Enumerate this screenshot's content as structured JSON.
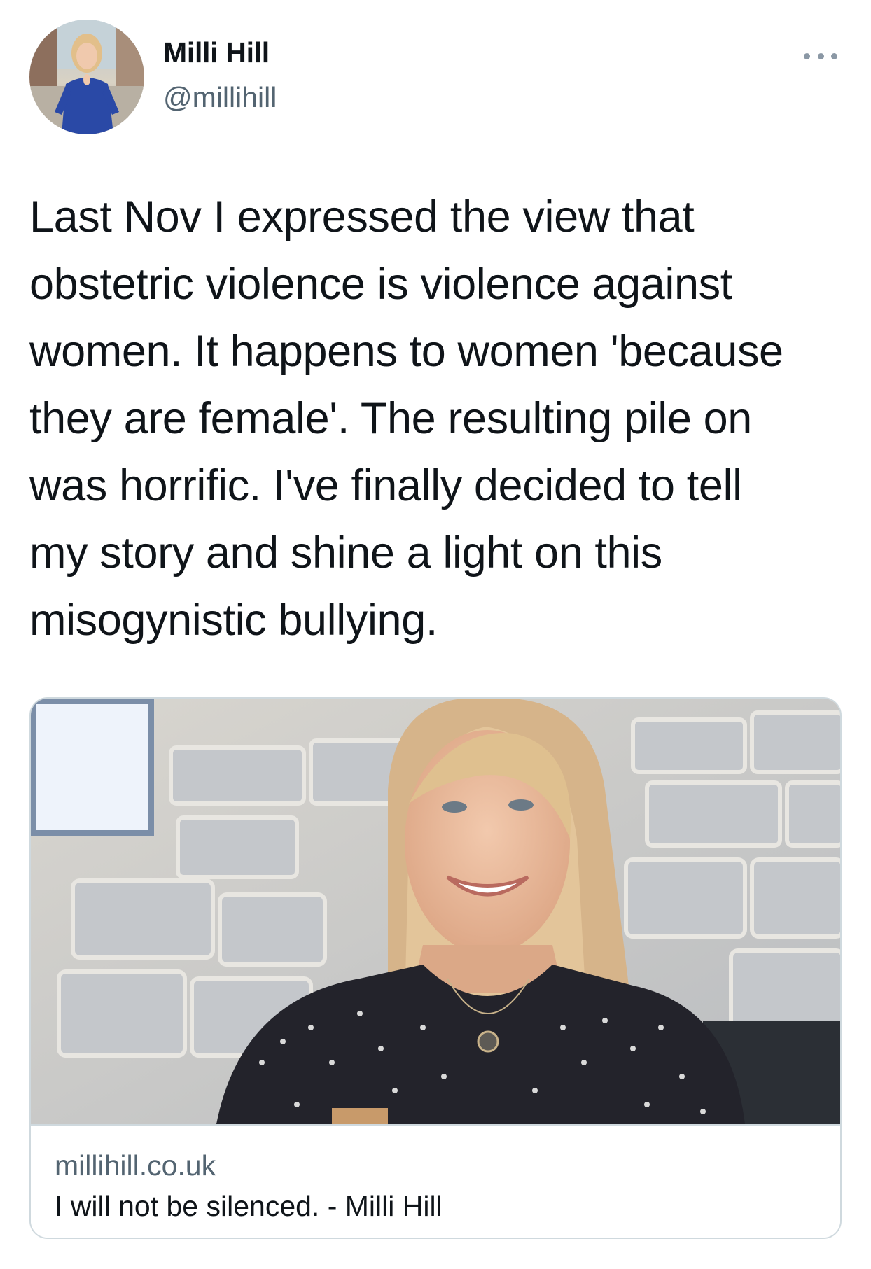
{
  "author": {
    "name": "Milli Hill",
    "handle": "@millihill"
  },
  "tweet": {
    "text": "Last Nov I expressed the view that\nobstetric violence is violence against\nwomen. It happens to women 'because\nthey are female'. The resulting pile on\nwas horrific. I've finally decided to tell\nmy story and shine a light on this\nmisogynistic bullying."
  },
  "link_card": {
    "domain": "millihill.co.uk",
    "title": "I will not be silenced. - Milli Hill"
  },
  "icons": {
    "more": "more-horizontal-icon"
  },
  "colors": {
    "text": "#0f1419",
    "secondary": "#536471",
    "border": "#cfd9de"
  }
}
